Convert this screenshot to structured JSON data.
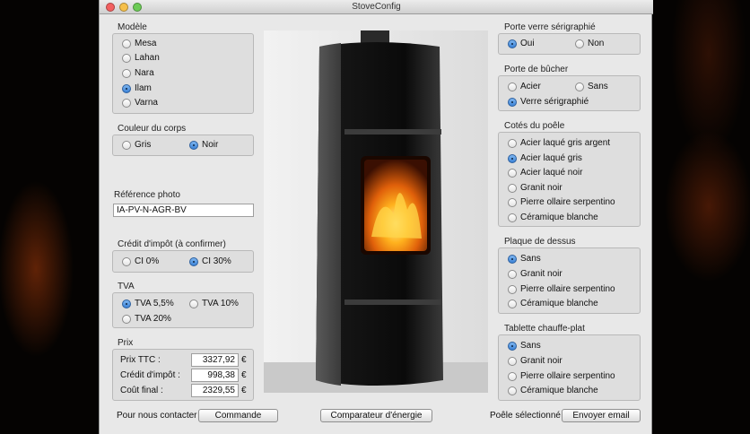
{
  "window": {
    "title": "StoveConfig"
  },
  "modele": {
    "title": "Modèle",
    "options": [
      "Mesa",
      "Lahan",
      "Nara",
      "Ilam",
      "Varna"
    ],
    "selected": "Ilam"
  },
  "couleur": {
    "title": "Couleur du corps",
    "options": [
      "Gris",
      "Noir"
    ],
    "selected": "Noir"
  },
  "reference": {
    "title": "Référence photo",
    "value": "IA-PV-N-AGR-BV"
  },
  "credit": {
    "title": "Crédit d'impôt (à confirmer)",
    "options": [
      "CI 0%",
      "CI 30%"
    ],
    "selected": "CI 30%"
  },
  "tva": {
    "title": "TVA",
    "options": [
      "TVA 5,5%",
      "TVA 10%",
      "TVA 20%"
    ],
    "selected": "TVA 5,5%"
  },
  "prix": {
    "title": "Prix",
    "rows": [
      {
        "label": "Prix TTC :",
        "value": "3327,92",
        "unit": "€"
      },
      {
        "label": "Crédit d'impôt :",
        "value": "998,38",
        "unit": "€"
      },
      {
        "label": "Coût final :",
        "value": "2329,55",
        "unit": "€"
      }
    ]
  },
  "porte_verre": {
    "title": "Porte verre sérigraphié",
    "options": [
      "Oui",
      "Non"
    ],
    "selected": "Oui"
  },
  "porte_bucher": {
    "title": "Porte de bûcher",
    "options": [
      "Acier",
      "Sans",
      "Verre sérigraphié"
    ],
    "selected": "Verre sérigraphié"
  },
  "cotes": {
    "title": "Cotés du poêle",
    "options": [
      "Acier laqué gris argent",
      "Acier laqué gris",
      "Acier laqué noir",
      "Granit noir",
      "Pierre ollaire serpentino",
      "Céramique blanche"
    ],
    "selected": "Acier laqué gris"
  },
  "plaque": {
    "title": "Plaque de dessus",
    "options": [
      "Sans",
      "Granit noir",
      "Pierre ollaire serpentino",
      "Céramique blanche"
    ],
    "selected": "Sans"
  },
  "tablette": {
    "title": "Tablette chauffe-plat",
    "options": [
      "Sans",
      "Granit noir",
      "Pierre ollaire serpentino",
      "Céramique blanche"
    ],
    "selected": "Sans"
  },
  "footer": {
    "contact_label": "Pour nous contacter",
    "commande_button": "Commande",
    "comparateur_button": "Comparateur d'énergie",
    "selected_label": "Poêle sélectionné",
    "email_button": "Envoyer email"
  }
}
